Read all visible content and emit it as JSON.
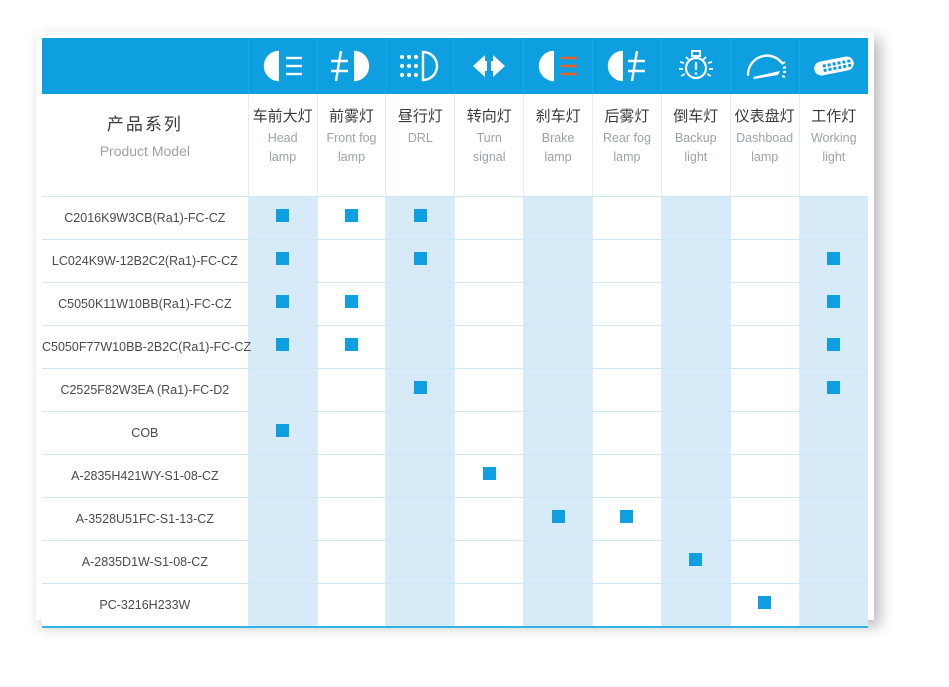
{
  "table": {
    "model_column": {
      "title_cn": "产品系列",
      "title_en": "Product Model"
    },
    "columns": [
      {
        "icon": "head-lamp-icon",
        "cn": "车前大灯",
        "en_line1": "Head",
        "en_line2": "lamp"
      },
      {
        "icon": "front-fog-lamp-icon",
        "cn": "前雾灯",
        "en_line1": "Front fog",
        "en_line2": "lamp"
      },
      {
        "icon": "drl-icon",
        "cn": "昼行灯",
        "en_line1": "DRL",
        "en_line2": ""
      },
      {
        "icon": "turn-signal-icon",
        "cn": "转向灯",
        "en_line1": "Turn",
        "en_line2": "signal"
      },
      {
        "icon": "brake-lamp-icon",
        "cn": "刹车灯",
        "en_line1": "Brake",
        "en_line2": "lamp"
      },
      {
        "icon": "rear-fog-lamp-icon",
        "cn": "后雾灯",
        "en_line1": "Rear fog",
        "en_line2": "lamp"
      },
      {
        "icon": "backup-light-icon",
        "cn": "倒车灯",
        "en_line1": "Backup",
        "en_line2": "light"
      },
      {
        "icon": "dashboard-lamp-icon",
        "cn": "仪表盘灯",
        "en_line1": "Dashboad",
        "en_line2": "lamp"
      },
      {
        "icon": "working-light-icon",
        "cn": "工作灯",
        "en_line1": "Working",
        "en_line2": "light"
      }
    ],
    "rows": [
      {
        "model": "C2016K9W3CB(Ra1)-FC-CZ",
        "marks": [
          1,
          1,
          1,
          0,
          0,
          0,
          0,
          0,
          0
        ]
      },
      {
        "model": "LC024K9W-12B2C2(Ra1)-FC-CZ",
        "marks": [
          1,
          0,
          1,
          0,
          0,
          0,
          0,
          0,
          1
        ]
      },
      {
        "model": "C5050K11W10BB(Ra1)-FC-CZ",
        "marks": [
          1,
          1,
          0,
          0,
          0,
          0,
          0,
          0,
          1
        ]
      },
      {
        "model": "C5050F77W10BB-2B2C(Ra1)-FC-CZ",
        "marks": [
          1,
          1,
          0,
          0,
          0,
          0,
          0,
          0,
          1
        ]
      },
      {
        "model": "C2525F82W3EA (Ra1)-FC-D2",
        "marks": [
          0,
          0,
          1,
          0,
          0,
          0,
          0,
          0,
          1
        ]
      },
      {
        "model": "COB",
        "marks": [
          1,
          0,
          0,
          0,
          0,
          0,
          0,
          0,
          0
        ]
      },
      {
        "model": "A-2835H421WY-S1-08-CZ",
        "marks": [
          0,
          0,
          0,
          1,
          0,
          0,
          0,
          0,
          0
        ]
      },
      {
        "model": "A-3528U51FC-S1-13-CZ",
        "marks": [
          0,
          0,
          0,
          0,
          1,
          1,
          0,
          0,
          0
        ]
      },
      {
        "model": "A-2835D1W-S1-08-CZ",
        "marks": [
          0,
          0,
          0,
          0,
          0,
          0,
          1,
          0,
          0
        ]
      },
      {
        "model": "PC-3216H233W",
        "marks": [
          0,
          0,
          0,
          0,
          0,
          0,
          0,
          1,
          0
        ]
      }
    ]
  },
  "colors": {
    "header_blue": "#0D9FE0",
    "mark_blue": "#0D9FE0",
    "shade_blue": "#D6EAF8",
    "grid_line": "#CFE8F5",
    "bottom_rule": "#35B4E3",
    "cn_text": "#3A3A3A",
    "en_text": "#9AA3A8",
    "icon_accent_orange": "#E2622B"
  }
}
